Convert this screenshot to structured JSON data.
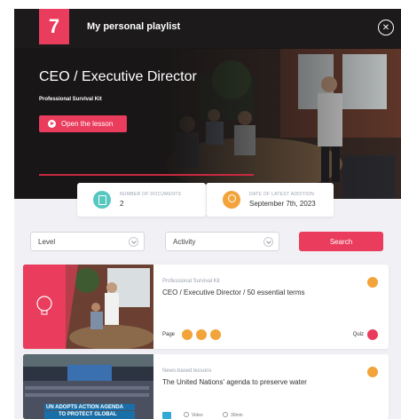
{
  "header": {
    "logo_text": "7",
    "title": "My personal playlist",
    "close_icon": "close-icon"
  },
  "hero": {
    "title": "CEO / Executive Director",
    "subtitle": "Professional Survival Kit",
    "open_button": "Open the lesson"
  },
  "stats": {
    "documents_label": "NUMBER OF DOCUMENTS",
    "documents_value": "2",
    "date_label": "DATE OF LATEST ADDITION",
    "date_value": "September 7th, 2023"
  },
  "filters": {
    "level": "Level",
    "activity": "Activity",
    "search_button": "Search"
  },
  "cards": [
    {
      "category": "Professional Survival Kit",
      "title": "CEO / Executive Director / 50 essential terms",
      "page_label": "Page",
      "quiz_label": "Quiz"
    },
    {
      "category": "News-based lessons",
      "title": "The United Nations' agenda to preserve water",
      "banner_line1": "UN ADOPTS ACTION AGENDA",
      "banner_line2": "TO PROTECT GLOBAL",
      "meta1": "Video",
      "meta2": "30min"
    }
  ],
  "colors": {
    "brand": "#ea3c5c",
    "accent_orange": "#f2a33a",
    "accent_teal": "#56c8c0",
    "dark": "#181616"
  }
}
